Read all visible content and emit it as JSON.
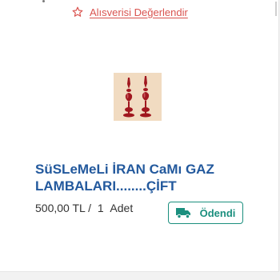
{
  "review": {
    "label": "Alısverisi Değerlendir",
    "icon": "star-outline-icon",
    "color": "#d9534f"
  },
  "product": {
    "image_alt": "decorative red glass oil lamp pair",
    "title": "SüSLeMeLi İRAN CaMı GAZ LAMBALARI........ÇİFT",
    "price": "500,00 TL",
    "separator": "/",
    "quantity": "1",
    "unit": "Adet"
  },
  "status": {
    "label": "Ödendi",
    "icon": "truck-icon",
    "color": "#1b8f7e"
  },
  "title_color": "#23599d"
}
